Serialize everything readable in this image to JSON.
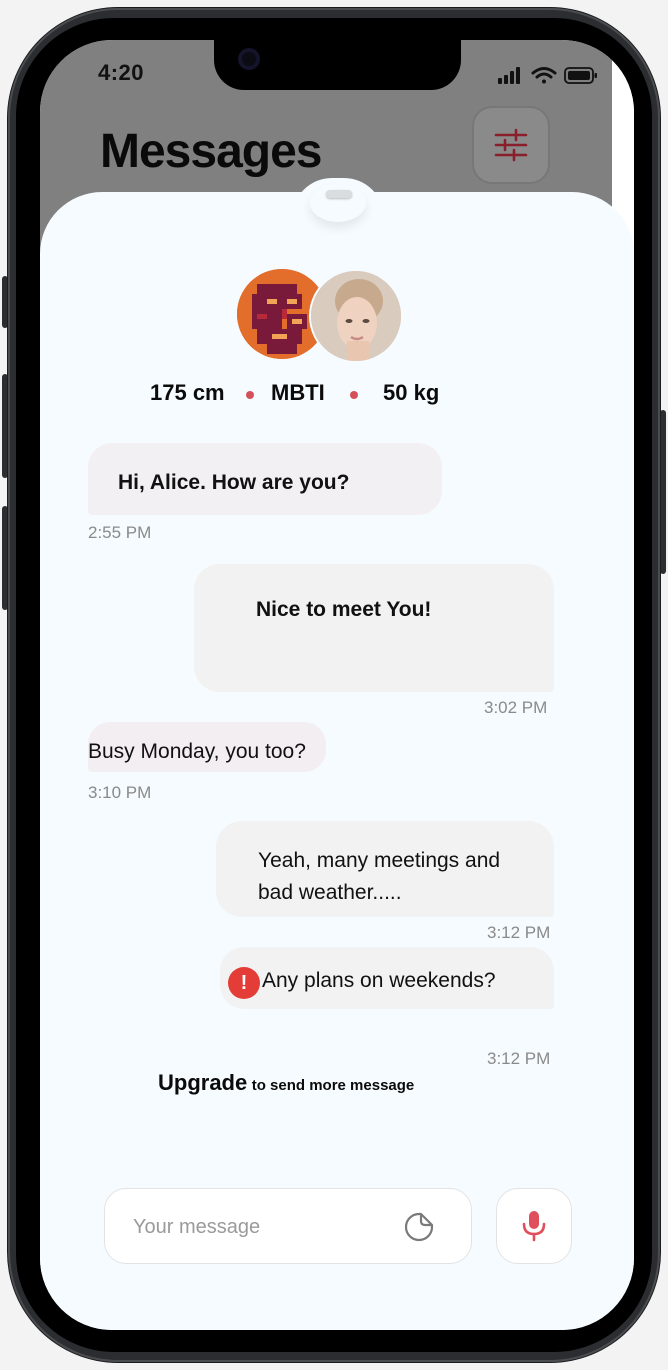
{
  "status_bar": {
    "time": "4:20"
  },
  "header": {
    "title": "Messages"
  },
  "profile": {
    "stats": [
      "175 cm",
      "MBTI",
      "50 kg"
    ],
    "accent_color": "#d6505a"
  },
  "messages": [
    {
      "text": "Hi, Alice. How are you?",
      "time": "2:55 PM",
      "direction": "incoming"
    },
    {
      "text": "Nice to meet You!",
      "time": "3:02 PM",
      "direction": "outgoing"
    },
    {
      "text": "Busy Monday, you too?",
      "time": "3:10 PM",
      "direction": "incoming"
    },
    {
      "text": "Yeah, many meetings and",
      "text2": "bad weather.....",
      "time": "3:12 PM",
      "direction": "outgoing"
    },
    {
      "text": "Any plans on weekends?",
      "time": "3:12 PM",
      "direction": "outgoing",
      "status": "error"
    }
  ],
  "upgrade": {
    "strong": "Upgrade",
    "rest": "to send more message"
  },
  "composer": {
    "placeholder": "Your message"
  },
  "icons": {
    "filter": "sliders-icon",
    "sticker": "sticker-icon",
    "mic": "microphone-icon",
    "error": "exclamation-icon"
  },
  "error_glyph": "!"
}
